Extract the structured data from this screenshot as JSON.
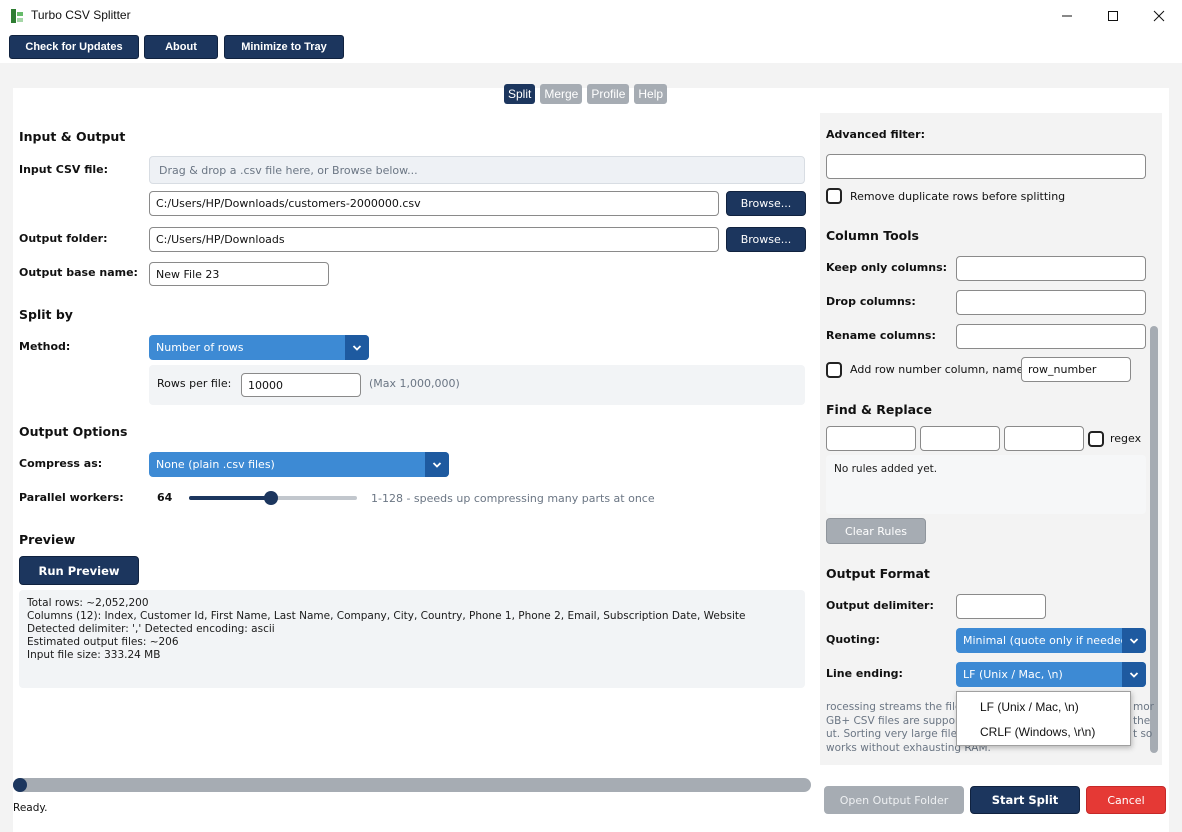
{
  "window": {
    "title": "Turbo CSV Splitter"
  },
  "toolbar": {
    "check_updates": "Check for Updates",
    "about": "About",
    "minimize_tray": "Minimize to Tray"
  },
  "tabs": [
    "Split",
    "Merge",
    "Profile",
    "Help"
  ],
  "input_output": {
    "section": "Input & Output",
    "input_label": "Input CSV file:",
    "drop_placeholder": "Drag & drop a .csv file here, or Browse below...",
    "input_path": "C:/Users/HP/Downloads/customers-2000000.csv",
    "browse": "Browse...",
    "output_label": "Output folder:",
    "output_path": "C:/Users/HP/Downloads",
    "basename_label": "Output base name:",
    "basename": "New File 23"
  },
  "split_by": {
    "section": "Split by",
    "method_label": "Method:",
    "method": "Number of rows",
    "rows_label": "Rows per file:",
    "rows_value": "10000",
    "rows_hint": "(Max 1,000,000)"
  },
  "output_options": {
    "section": "Output Options",
    "compress_label": "Compress as:",
    "compress_value": "None (plain .csv files)",
    "workers_label": "Parallel workers:",
    "workers_value": "64",
    "workers_fraction": 0.49,
    "workers_hint": "1-128 - speeds up compressing many parts at once"
  },
  "preview": {
    "section": "Preview",
    "run": "Run Preview",
    "lines": [
      "Total rows: ~2,052,200",
      "Columns (12): Index, Customer Id, First Name, Last Name, Company, City, Country, Phone 1, Phone 2, Email, Subscription Date, Website",
      "Detected delimiter: ','   Detected encoding: ascii",
      "Estimated output files: ~206",
      "Input file size: 333.24 MB"
    ]
  },
  "right": {
    "advanced_filter": "Advanced filter:",
    "remove_dupes": "Remove duplicate rows before splitting",
    "column_tools": "Column Tools",
    "keep_only": "Keep only columns:",
    "drop_columns": "Drop columns:",
    "rename_columns": "Rename columns:",
    "add_rownum": "Add row number column, named:",
    "rownum_value": "row_number",
    "find_replace": "Find & Replace",
    "regex": "regex",
    "no_rules": "No rules added yet.",
    "clear_rules": "Clear Rules",
    "output_format": "Output Format",
    "delimiter_label": "Output delimiter:",
    "quoting_label": "Quoting:",
    "quoting_value": "Minimal (quote only if needed)",
    "line_ending_label": "Line ending:",
    "line_ending_value": "LF (Unix / Mac, \\n)",
    "info_lines": [
      "rocessing streams the file",
      "GB+ CSV files are supporte",
      "ut. Sorting very large files",
      "works without exhausting RAM."
    ],
    "info_right": [
      "mor",
      "the",
      "t so"
    ]
  },
  "dropdown": {
    "options": [
      "LF (Unix / Mac, \\n)",
      "CRLF (Windows, \\r\\n)"
    ]
  },
  "status": {
    "text": "Ready.",
    "progress": 0.01
  },
  "actions": {
    "open_folder": "Open Output Folder",
    "start": "Start Split",
    "cancel": "Cancel"
  },
  "colors": {
    "navy": "#1c365e",
    "blue": "#3d8ad4",
    "red": "#e53935",
    "gray": "#a6acb3"
  }
}
